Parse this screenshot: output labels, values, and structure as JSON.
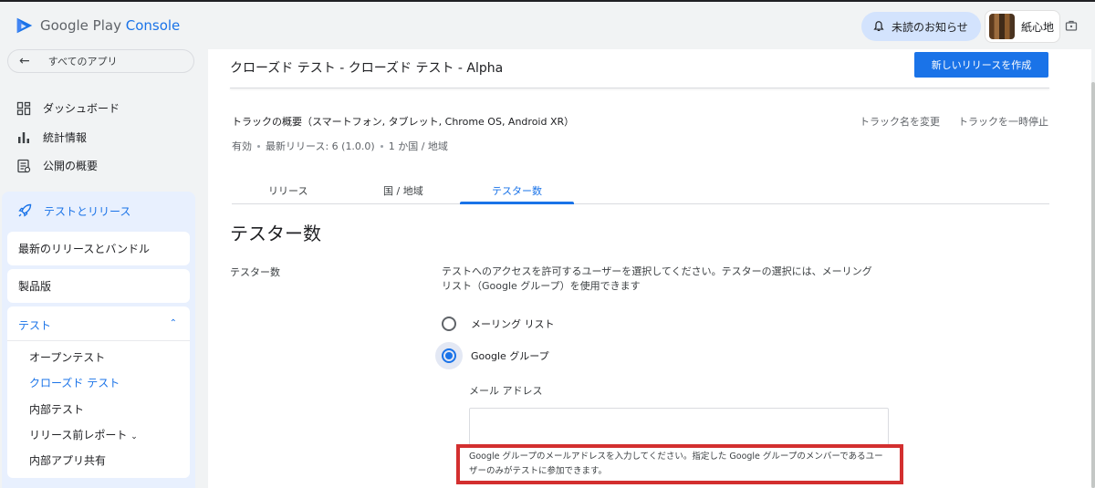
{
  "brand": {
    "part1": "Google Play",
    "part2": "Console"
  },
  "header": {
    "notifications_label": "未読のお知らせ",
    "account_name": "紙心地"
  },
  "sidebar": {
    "back_label": "すべてのアプリ",
    "items": [
      {
        "label": "ダッシュボード",
        "icon": "dashboard-icon"
      },
      {
        "label": "統計情報",
        "icon": "bar-chart-icon"
      },
      {
        "label": "公開の概要",
        "icon": "publishing-overview-icon"
      }
    ],
    "section_label": "テストとリリース",
    "cards": [
      {
        "label": "最新のリリースとバンドル"
      },
      {
        "label": "製品版"
      }
    ],
    "test_group": {
      "label": "テスト",
      "sub_items": [
        "オープンテスト",
        "クローズド テスト",
        "内部テスト",
        "リリース前レポート",
        "内部アプリ共有"
      ]
    }
  },
  "main": {
    "title": "クローズド テスト - クローズド テスト - Alpha",
    "create_release_button": "新しいリリースを作成",
    "track_overview": "トラックの概要（スマートフォン, タブレット, Chrome OS, Android XR）",
    "rename_track": "トラック名を変更",
    "pause_track": "トラックを一時停止",
    "status": {
      "state": "有効",
      "latest_release": "最新リリース: 6 (1.0.0)",
      "countries": "1 か国 / 地域"
    },
    "tabs": [
      {
        "label": "リリース"
      },
      {
        "label": "国 / 地域"
      },
      {
        "label": "テスター数"
      }
    ],
    "section_heading": "テスター数",
    "field_label": "テスター数",
    "description": "テストへのアクセスを許可するユーザーを選択してください。テスターの選択には、メーリング リスト（Google グループ）を使用できます",
    "options": [
      {
        "label": "メーリング リスト",
        "selected": false
      },
      {
        "label": "Google グループ",
        "selected": true
      }
    ],
    "email_label": "メール アドレス",
    "email_value": "",
    "hint": "Google グループのメールアドレスを入力してください。指定した Google グループのメンバーであるユーザーのみがテストに参加できます。"
  },
  "colors": {
    "accent": "#1a73e8",
    "highlight_box": "#d32f2f",
    "section_bg": "#e8f0fe"
  }
}
